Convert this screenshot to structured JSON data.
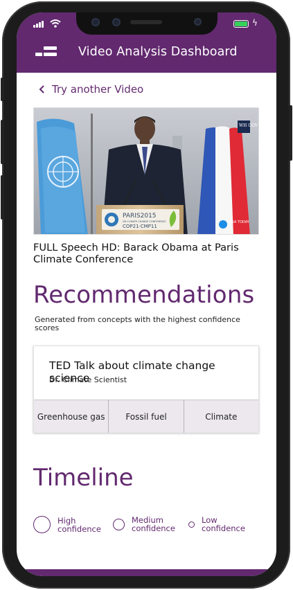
{
  "app": {
    "title": "Video Analysis Dashboard"
  },
  "nav": {
    "back_label": "Try another Video"
  },
  "video": {
    "title": "FULL Speech HD: Barack Obama at Paris Climate Conference",
    "podium_line1": "PARIS2015",
    "podium_line2": "UN CLIMATE CHANGE CONFERENCE",
    "podium_line3": "COP21·CMP11",
    "watermark_wh": "WH GOV",
    "watermark_usa": "USA TODAY"
  },
  "recommendations": {
    "heading": "Recommendations",
    "subtitle": "Generated from concepts with the highest confidence scores",
    "items": [
      {
        "title": "TED Talk about climate change science",
        "author": "Dr. Climate Scientist",
        "tags": [
          "Greenhouse gas",
          "Fossil fuel",
          "Climate"
        ]
      }
    ]
  },
  "timeline": {
    "heading": "Timeline",
    "legend": [
      {
        "label": "High confidence"
      },
      {
        "label": "Medium confidence"
      },
      {
        "label": "Low confidence"
      }
    ]
  },
  "colors": {
    "brand": "#62296f",
    "tag_bg": "#ece8ee",
    "battery": "#36d15a"
  },
  "icons": [
    "menu-icon",
    "chevron-left-icon",
    "signal-icon",
    "wifi-icon",
    "battery-icon"
  ]
}
